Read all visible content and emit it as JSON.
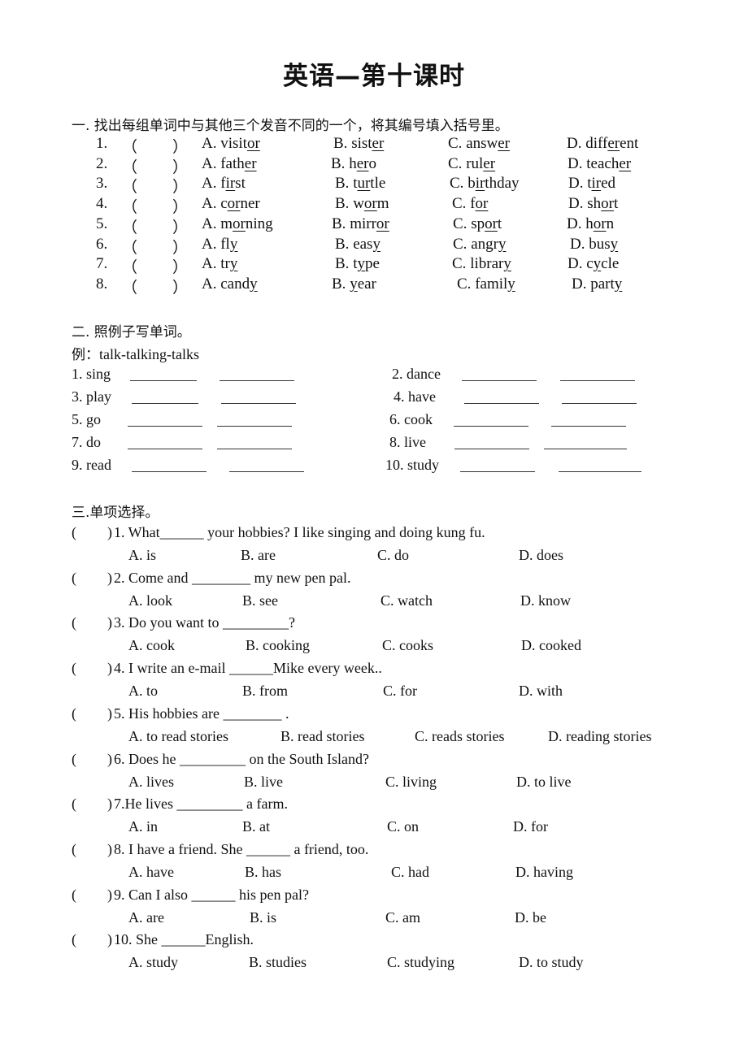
{
  "title": "英语—第十课时",
  "section1": {
    "heading": "一. 找出每组单词中与其他三个发音不同的一个，将其编号填入括号里。",
    "rows": [
      {
        "num": "1.",
        "options": [
          {
            "label": "A.",
            "pre": "visit",
            "ul": "or",
            "post": ""
          },
          {
            "label": "B.",
            "pre": "sist",
            "ul": "er",
            "post": ""
          },
          {
            "label": "C.",
            "pre": "answ",
            "ul": "er",
            "post": ""
          },
          {
            "label": "D.",
            "pre": "diff",
            "ul": "er",
            "post": "ent"
          }
        ]
      },
      {
        "num": "2.",
        "options": [
          {
            "label": "A.",
            "pre": "fath",
            "ul": "er",
            "post": ""
          },
          {
            "label": "B.",
            "pre": "h",
            "ul": "er",
            "post": "o"
          },
          {
            "label": "C.",
            "pre": "rul",
            "ul": "er",
            "post": ""
          },
          {
            "label": "D.",
            "pre": "teach",
            "ul": "er",
            "post": ""
          }
        ]
      },
      {
        "num": "3.",
        "options": [
          {
            "label": "A.",
            "pre": "f",
            "ul": "ir",
            "post": "st"
          },
          {
            "label": "B.",
            "pre": "t",
            "ul": "ur",
            "post": "tle"
          },
          {
            "label": "C.",
            "pre": "b",
            "ul": "ir",
            "post": "thday"
          },
          {
            "label": "D.",
            "pre": "t",
            "ul": "ir",
            "post": "ed"
          }
        ]
      },
      {
        "num": "4.",
        "options": [
          {
            "label": "A.",
            "pre": "c",
            "ul": "or",
            "post": "ner"
          },
          {
            "label": "B.",
            "pre": "w",
            "ul": "or",
            "post": "m"
          },
          {
            "label": "C.",
            "pre": "f",
            "ul": "or",
            "post": ""
          },
          {
            "label": "D.",
            "pre": "sh",
            "ul": "or",
            "post": "t"
          }
        ]
      },
      {
        "num": "5.",
        "options": [
          {
            "label": "A.",
            "pre": "m",
            "ul": "or",
            "post": "ning"
          },
          {
            "label": "B.",
            "pre": "mirr",
            "ul": "or",
            "post": ""
          },
          {
            "label": "C.",
            "pre": "sp",
            "ul": "or",
            "post": "t"
          },
          {
            "label": "D.",
            "pre": "h",
            "ul": "or",
            "post": "n"
          }
        ]
      },
      {
        "num": "6.",
        "options": [
          {
            "label": "A.",
            "pre": "fl",
            "ul": "y",
            "post": ""
          },
          {
            "label": "B.",
            "pre": "eas",
            "ul": "y",
            "post": ""
          },
          {
            "label": "C.",
            "pre": "angr",
            "ul": "y",
            "post": ""
          },
          {
            "label": "D.",
            "pre": "bus",
            "ul": "y",
            "post": ""
          }
        ]
      },
      {
        "num": "7.",
        "options": [
          {
            "label": "A.",
            "pre": "tr",
            "ul": "y",
            "post": ""
          },
          {
            "label": "B.",
            "pre": "t",
            "ul": "y",
            "post": "pe"
          },
          {
            "label": "C.",
            "pre": "librar",
            "ul": "y",
            "post": ""
          },
          {
            "label": "D.",
            "pre": "c",
            "ul": "y",
            "post": "cle"
          }
        ]
      },
      {
        "num": "8.",
        "options": [
          {
            "label": "A.",
            "pre": "cand",
            "ul": "y",
            "post": ""
          },
          {
            "label": "B.",
            "pre": "",
            "ul": "y",
            "post": "ear"
          },
          {
            "label": "C.",
            "pre": "famil",
            "ul": "y",
            "post": ""
          },
          {
            "label": "D.",
            "pre": "part",
            "ul": "y",
            "post": ""
          }
        ]
      }
    ],
    "paren_open": "（",
    "paren_close": "）"
  },
  "section2": {
    "heading": "二. 照例子写单词。",
    "example_label": "例：",
    "example": "talk-talking-talks",
    "items": [
      {
        "label": "1. sing"
      },
      {
        "label": "2. dance"
      },
      {
        "label": "3. play"
      },
      {
        "label": "4. have"
      },
      {
        "label": "5. go"
      },
      {
        "label": "6. cook"
      },
      {
        "label": "7. do"
      },
      {
        "label": "8. live"
      },
      {
        "label": "9. read"
      },
      {
        "label": "10. study"
      }
    ]
  },
  "section3": {
    "heading": "三.单项选择。",
    "paren_open": "(",
    "paren_close": ")",
    "questions": [
      {
        "pre": "1. What",
        "blank": "______",
        "post": " your hobbies? I like singing and doing kung fu.",
        "options": [
          "A. is",
          "B. are",
          "C. do",
          "D. does"
        ]
      },
      {
        "pre": "2. Come and ",
        "blank": "________",
        "post": " my new pen pal.",
        "options": [
          "A. look",
          "B. see",
          "C. watch",
          "D. know"
        ]
      },
      {
        "pre": "3. Do you want to ",
        "blank": "_________",
        "post": "?",
        "options": [
          "A. cook",
          "B. cooking",
          "C. cooks",
          "D. cooked"
        ]
      },
      {
        "pre": "4. I write an e-mail ",
        "blank": "______",
        "post": "Mike every week..",
        "options": [
          "A. to",
          "B. from",
          "C. for",
          "D. with"
        ]
      },
      {
        "pre": "5. His hobbies are ",
        "blank": "________",
        "post": " .",
        "options": [
          "A. to read stories",
          "B. read stories",
          "C. reads stories",
          "D. reading stories"
        ]
      },
      {
        "pre": "6. Does he ",
        "blank": "_________",
        "post": " on the South Island?",
        "options": [
          "A. lives",
          "B. live",
          "C. living",
          "D. to live"
        ]
      },
      {
        "pre": "7.He lives ",
        "blank": "_________",
        "post": " a farm.",
        "options": [
          "A. in",
          "B. at",
          "C. on",
          "D. for"
        ]
      },
      {
        "pre": "8. I have a friend. She ",
        "blank": "______",
        "post": " a friend, too.",
        "options": [
          "A. have",
          "B. has",
          "C. had",
          "D. having"
        ]
      },
      {
        "pre": "9. Can I also ",
        "blank": "______",
        "post": " his pen pal?",
        "options": [
          "A. are",
          "B. is",
          "C. am",
          "D. be"
        ]
      },
      {
        "pre": "10. She ",
        "blank": "______",
        "post": "English.",
        "options": [
          "A. study",
          "B. studies",
          "C. studying",
          "D. to study"
        ]
      }
    ]
  }
}
